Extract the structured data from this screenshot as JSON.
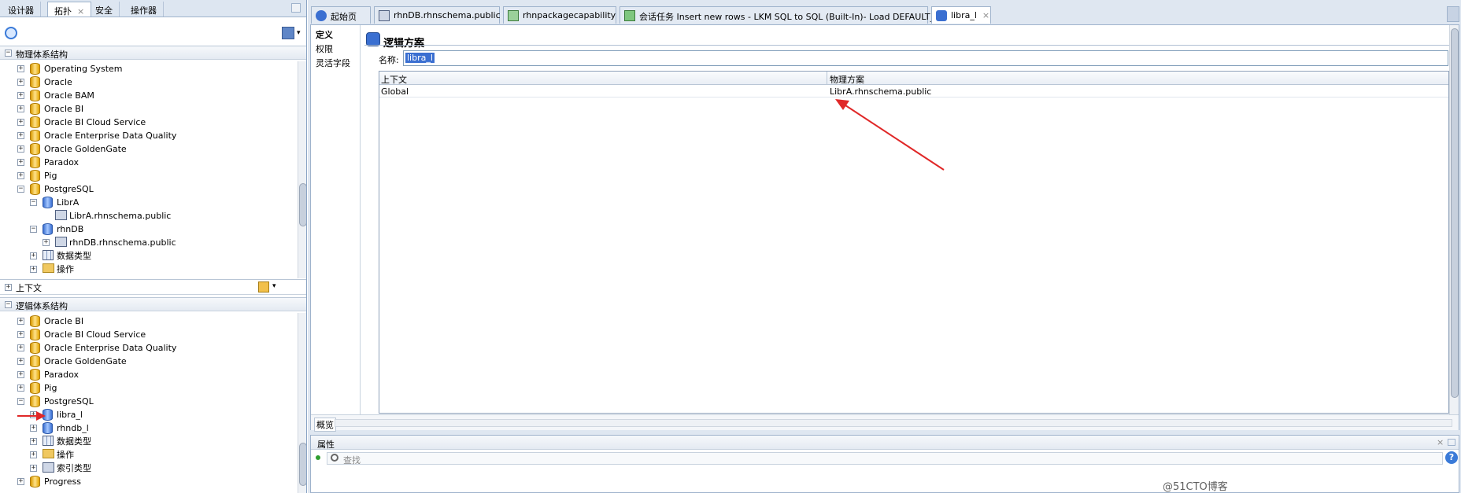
{
  "left_panel": {
    "tabs": [
      "设计器",
      "拓扑",
      "安全",
      "操作器"
    ],
    "physical_header": "物理体系结构",
    "physical_tree": [
      {
        "label": "Operating System",
        "icon": "db"
      },
      {
        "label": "Oracle",
        "icon": "db"
      },
      {
        "label": "Oracle BAM",
        "icon": "db"
      },
      {
        "label": "Oracle BI",
        "icon": "db"
      },
      {
        "label": "Oracle BI Cloud Service",
        "icon": "db"
      },
      {
        "label": "Oracle Enterprise Data Quality",
        "icon": "db"
      },
      {
        "label": "Oracle GoldenGate",
        "icon": "db"
      },
      {
        "label": "Paradox",
        "icon": "db"
      },
      {
        "label": "Pig",
        "icon": "db"
      },
      {
        "label": "PostgreSQL",
        "icon": "db"
      },
      {
        "label": "LibrA",
        "icon": "db-blue"
      },
      {
        "label": "LibrA.rhnschema.public",
        "icon": "schema"
      },
      {
        "label": "rhnDB",
        "icon": "db-blue"
      },
      {
        "label": "rhnDB.rhnschema.public",
        "icon": "schema"
      },
      {
        "label": "数据类型",
        "icon": "grid"
      },
      {
        "label": "操作",
        "icon": "folder"
      }
    ],
    "context_header": "上下文",
    "logical_header": "逻辑体系结构",
    "logical_tree": [
      {
        "label": "Oracle BI",
        "icon": "db"
      },
      {
        "label": "Oracle BI Cloud Service",
        "icon": "db"
      },
      {
        "label": "Oracle Enterprise Data Quality",
        "icon": "db"
      },
      {
        "label": "Oracle GoldenGate",
        "icon": "db"
      },
      {
        "label": "Paradox",
        "icon": "db"
      },
      {
        "label": "Pig",
        "icon": "db"
      },
      {
        "label": "PostgreSQL",
        "icon": "db"
      },
      {
        "label": "libra_l",
        "icon": "logical"
      },
      {
        "label": "rhndb_l",
        "icon": "logical"
      },
      {
        "label": "数据类型",
        "icon": "grid"
      },
      {
        "label": "操作",
        "icon": "folder"
      },
      {
        "label": "索引类型",
        "icon": "key"
      },
      {
        "label": "Progress",
        "icon": "db"
      }
    ]
  },
  "editor_tabs": [
    {
      "label": "起始页"
    },
    {
      "label": "rhnDB.rhnschema.public"
    },
    {
      "label": "rhnpackagecapability"
    },
    {
      "label": "会话任务 Insert new rows - LKM SQL to SQL (Built-In)- Load DEFAULT_AP"
    },
    {
      "label": "libra_l"
    }
  ],
  "editor": {
    "side_tabs": [
      "定义",
      "权限",
      "灵活字段"
    ],
    "title": "逻辑方案",
    "name_label": "名称:",
    "name_value": "libra_l",
    "table": {
      "headers": [
        "上下文",
        "物理方案"
      ],
      "rows": [
        [
          "Global",
          "LibrA.rhnschema.public"
        ]
      ]
    },
    "overview_tab": "概览"
  },
  "properties": {
    "title": "属性",
    "search_placeholder": "查找"
  },
  "watermark": "@51CTO博客"
}
